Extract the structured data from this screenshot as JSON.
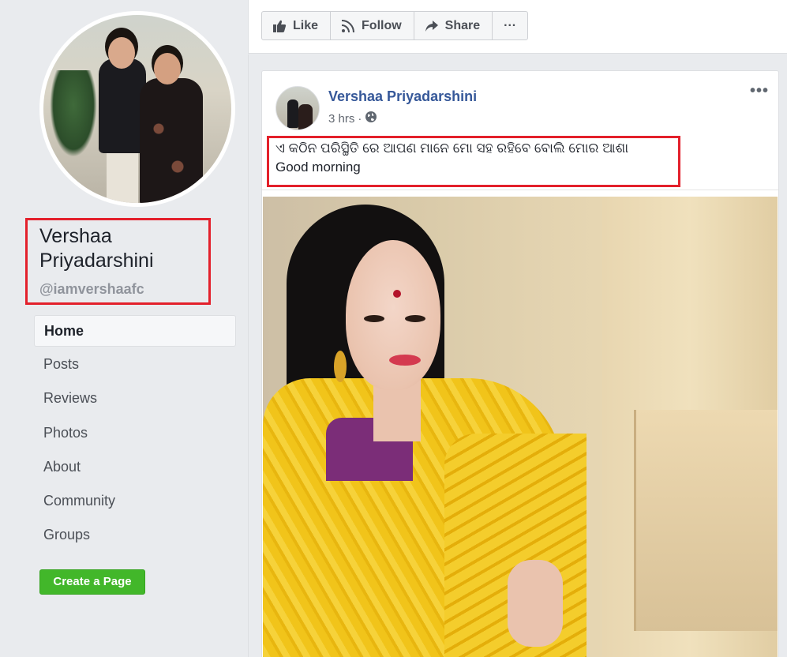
{
  "page": {
    "name": "Vershaa Priyadarshini",
    "handle": "@iamvershaafc"
  },
  "sidebar": {
    "items": [
      {
        "label": "Home",
        "active": true
      },
      {
        "label": "Posts"
      },
      {
        "label": "Reviews"
      },
      {
        "label": "Photos"
      },
      {
        "label": "About"
      },
      {
        "label": "Community"
      },
      {
        "label": "Groups"
      }
    ],
    "create_page_label": "Create a Page"
  },
  "actions": {
    "like": "Like",
    "follow": "Follow",
    "share": "Share",
    "more": "···"
  },
  "post": {
    "author": "Vershaa Priyadarshini",
    "time": "3 hrs",
    "separator": "·",
    "more": "•••",
    "text_line_1": "ଏ କଠିନ ପରିସ୍ଥିତି ରେ ଆପଣ ମାନେ ମୋ ସହ ରହିବେ ବୋଲି ମୋର ଆଶା",
    "text_line_2": "Good morning"
  },
  "colors": {
    "highlight_box": "#e3202b",
    "link_blue": "#365899",
    "create_button": "#42b72a"
  }
}
